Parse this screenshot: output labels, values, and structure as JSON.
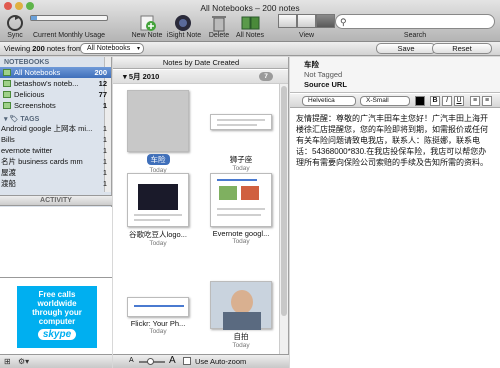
{
  "window": {
    "title": "All Notebooks – 200 notes"
  },
  "toolbar": {
    "sync_label": "Sync",
    "usage_label": "Current Monthly Usage",
    "usage_fraction": 0.08,
    "new_note_label": "New Note",
    "isight_label": "iSight Note",
    "delete_label": "Delete",
    "all_notes_label": "All Notes",
    "view_label": "View",
    "search_label": "Search",
    "search_placeholder": ""
  },
  "subbar": {
    "viewing_prefix": "Viewing",
    "count": "200",
    "viewing_suffix": "notes from",
    "notebook_selected": "All Notebooks",
    "save_label": "Save",
    "reset_label": "Reset"
  },
  "sidebar": {
    "notebooks_header": "NOTEBOOKS",
    "notebooks": [
      {
        "label": "All Notebooks",
        "count": "200",
        "selected": true
      },
      {
        "label": "betashow's noteb...",
        "count": "12"
      },
      {
        "label": "Delicious",
        "count": "77"
      },
      {
        "label": "Screenshots",
        "count": "1"
      }
    ],
    "tags_header": "TAGS",
    "tags": [
      {
        "label": "Android google 上网本 mi...",
        "count": "1"
      },
      {
        "label": "Bills",
        "count": "1"
      },
      {
        "label": "evernote twitter",
        "count": "1"
      },
      {
        "label": "名片 business cards mm",
        "count": "1"
      },
      {
        "label": "屋渡",
        "count": "1"
      },
      {
        "label": "渡船",
        "count": "1"
      }
    ],
    "activity_label": "ACTIVITY",
    "ad": {
      "line1": "Free calls",
      "line2": "worldwide",
      "line3": "through your",
      "line4": "computer",
      "brand": "skype"
    }
  },
  "notelist": {
    "sort_label": "Notes by Date Created",
    "group_label": "5月 2010",
    "group_count": "7",
    "notes": [
      {
        "title": "车险",
        "date": "Today",
        "selected": true
      },
      {
        "title": "狮子座",
        "date": "Today"
      },
      {
        "title": "谷歌吃豆人logo...",
        "date": "Today"
      },
      {
        "title": "Evernote googl...",
        "date": "Today"
      },
      {
        "title": "Flickr: Your Ph...",
        "date": "Today"
      },
      {
        "title": "自拍",
        "date": "Today"
      }
    ],
    "autozoom_label": "Use Auto-zoom"
  },
  "note": {
    "title": "车险",
    "tags": "Not Tagged",
    "source": "Source URL",
    "font": "Helvetica",
    "size": "X-Small",
    "bold": "B",
    "italic": "I",
    "underline": "U",
    "body": "友情提醒：尊敬的广汽丰田车主您好！广汽丰田上海开楼徐汇店提醒您，您的车险即将到期，如需报价或任何有关车险问题请致电我店，联系人：陈挺娜，联系电话：54368000*830.在我店投保车险，我店可以帮您办理所有需要向保险公司索赔的手续及告知所需的资料。"
  },
  "colors": {
    "selection": "#3f6fba",
    "skype": "#00aff0",
    "notebook_icon": "#9fd18a"
  }
}
